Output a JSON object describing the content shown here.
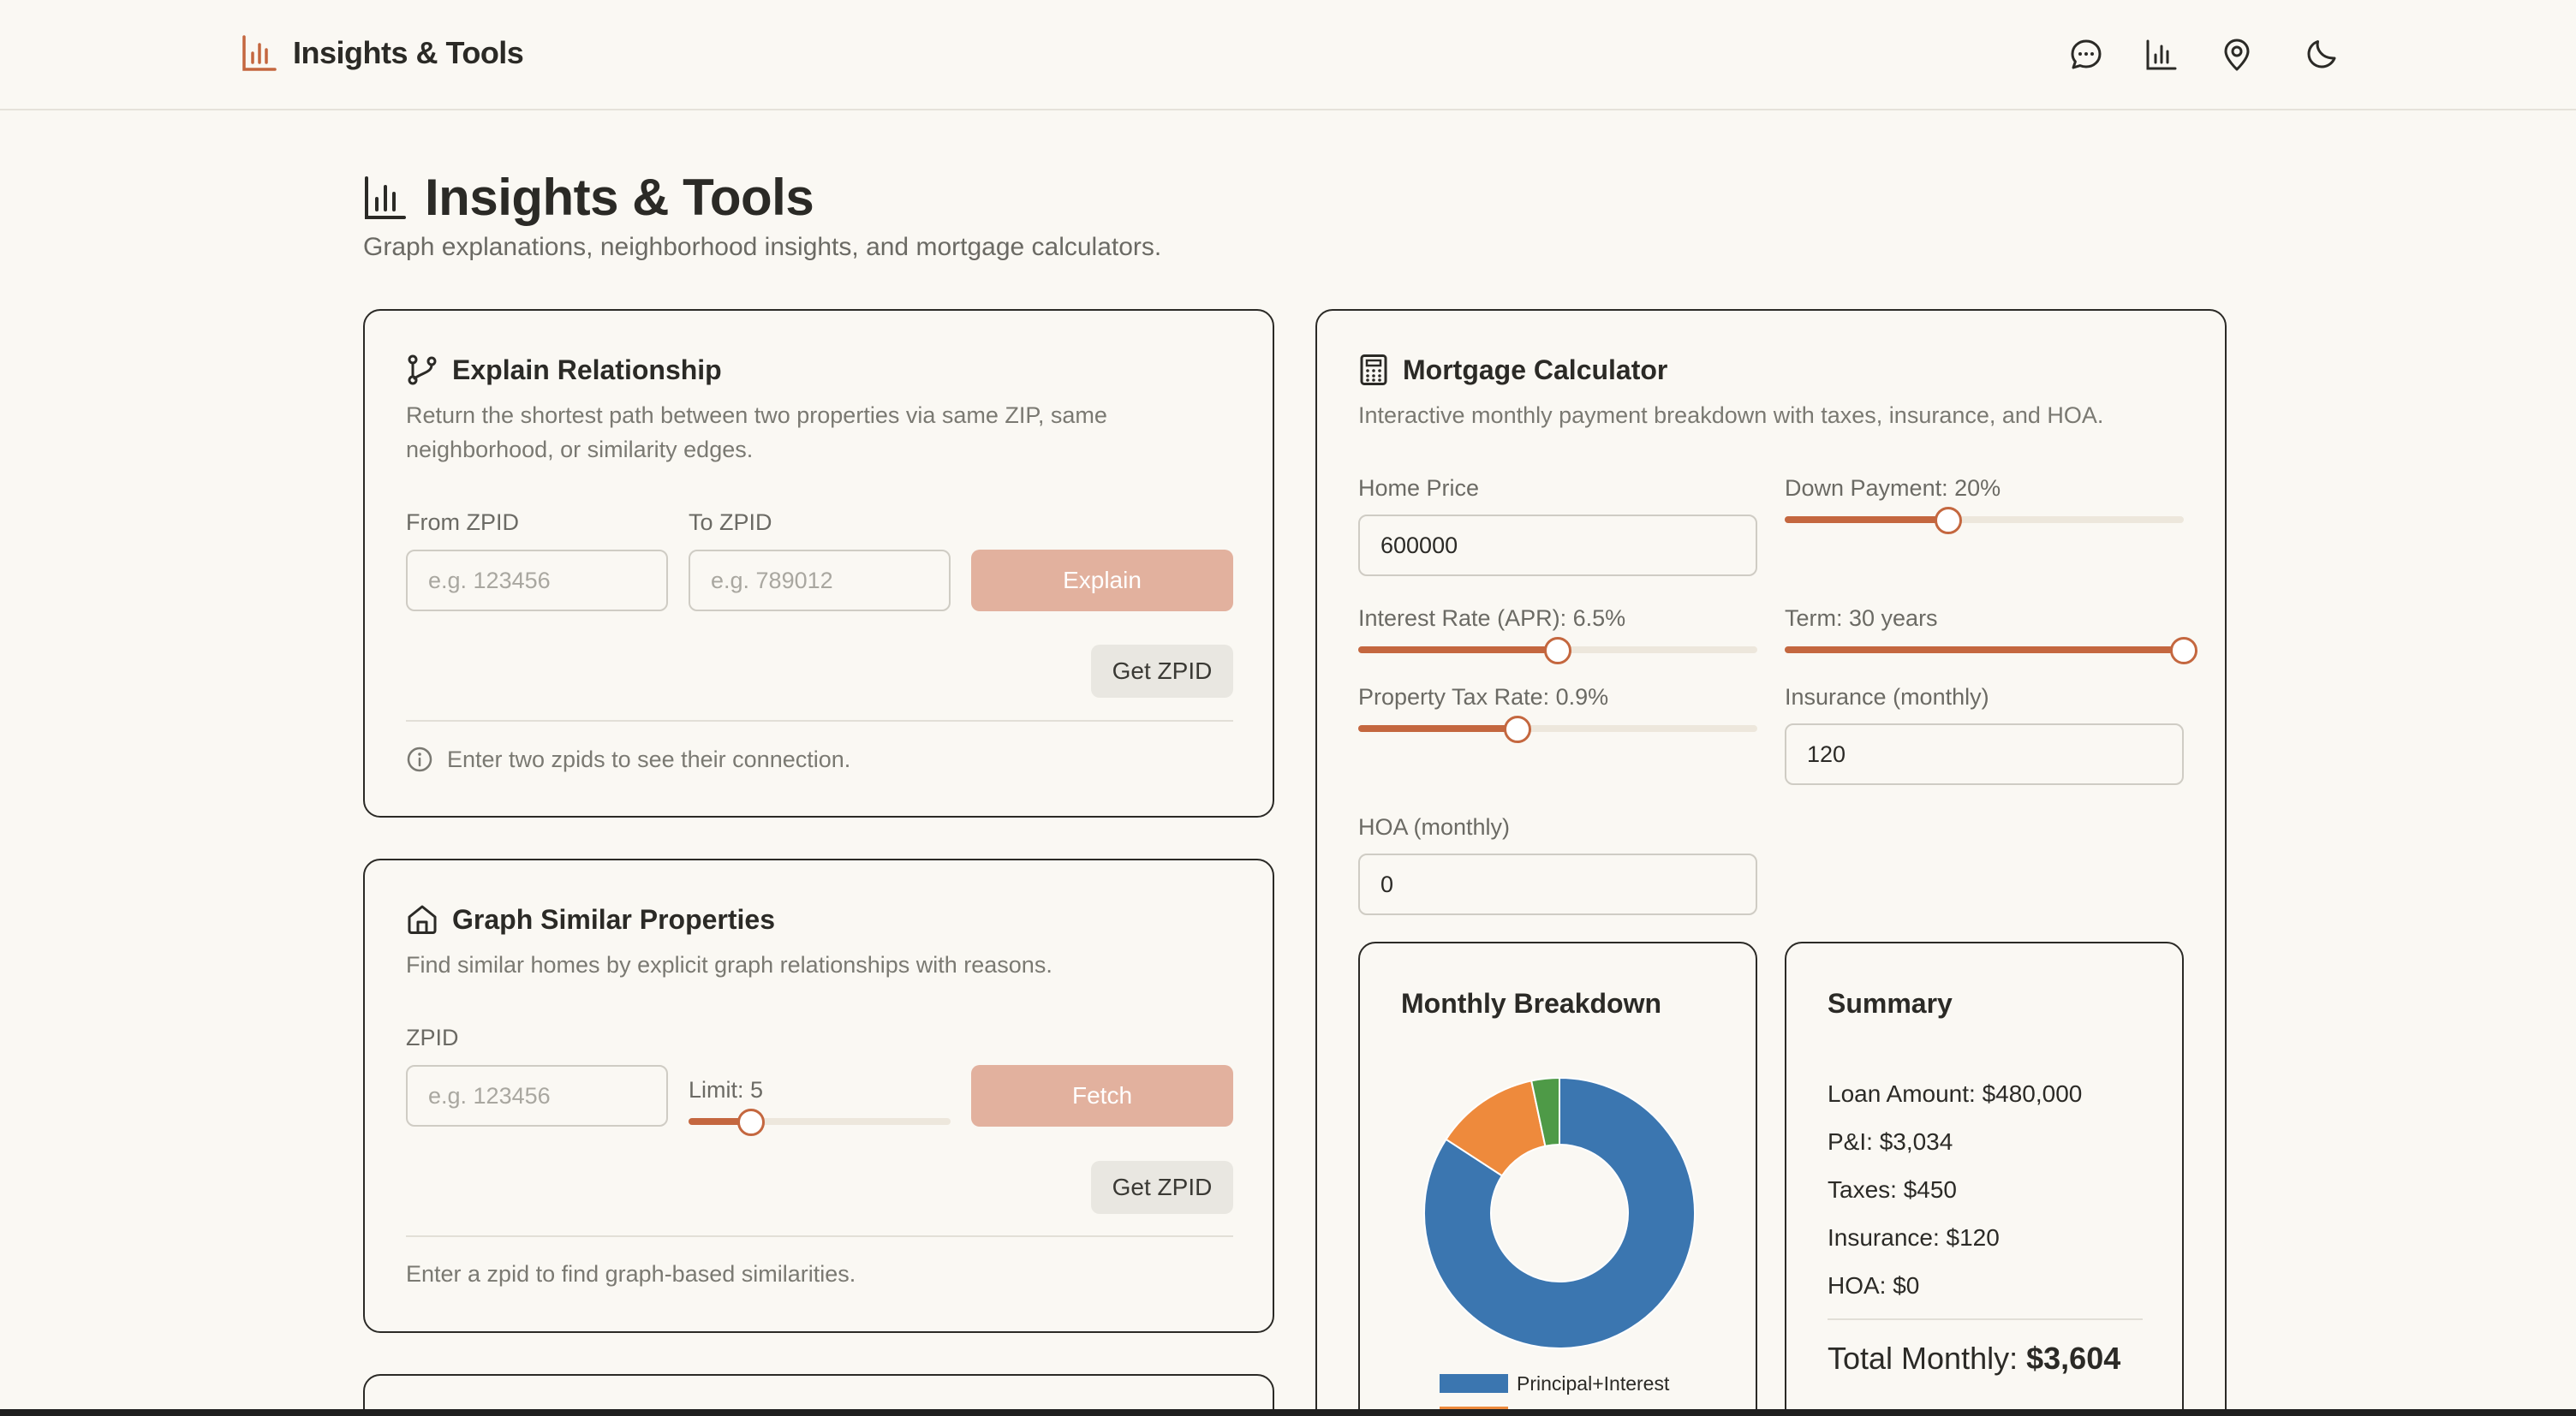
{
  "nav": {
    "brand": "Insights & Tools",
    "icons": [
      "chat-icon",
      "bar-chart-icon",
      "map-pin-icon",
      "moon-icon"
    ]
  },
  "page": {
    "title": "Insights & Tools",
    "subtitle": "Graph explanations, neighborhood insights, and mortgage calculators."
  },
  "explain": {
    "title": "Explain Relationship",
    "desc_line1": "Return the shortest path between two properties via same ZIP, same",
    "desc_line2": "neighborhood, or similarity edges.",
    "from_label": "From ZPID",
    "from_placeholder": "e.g. 123456",
    "to_label": "To ZPID",
    "to_placeholder": "e.g. 789012",
    "explain_button": "Explain",
    "get_zpid_button": "Get ZPID",
    "hint": "Enter two zpids to see their connection."
  },
  "similar": {
    "title": "Graph Similar Properties",
    "desc": "Find similar homes by explicit graph relationships with reasons.",
    "zpid_label": "ZPID",
    "zpid_placeholder": "e.g. 123456",
    "limit_label": "Limit: 5",
    "limit_value": 5,
    "limit_fraction": 0.24,
    "fetch_button": "Fetch",
    "get_zpid_button": "Get ZPID",
    "hint": "Enter a zpid to find graph-based similarities."
  },
  "mortgage": {
    "title": "Mortgage Calculator",
    "desc": "Interactive monthly payment breakdown with taxes, insurance, and HOA.",
    "home_price_label": "Home Price",
    "home_price_value": "600000",
    "down_payment_label": "Down Payment: 20%",
    "down_payment_fraction": 0.41,
    "interest_label": "Interest Rate (APR): 6.5%",
    "interest_fraction": 0.5,
    "term_label": "Term: 30 years",
    "term_fraction": 1.0,
    "tax_label": "Property Tax Rate: 0.9%",
    "tax_fraction": 0.4,
    "insurance_label": "Insurance (monthly)",
    "insurance_value": "120",
    "hoa_label": "HOA (monthly)",
    "hoa_value": "0",
    "breakdown_title": "Monthly Breakdown",
    "summary": {
      "title": "Summary",
      "loan_amount": "Loan Amount: $480,000",
      "pi": "P&I: $3,034",
      "taxes": "Taxes: $450",
      "insurance": "Insurance: $120",
      "hoa": "HOA: $0",
      "total_prefix": "Total Monthly:",
      "total_value": "$3,604"
    }
  },
  "chart_data": {
    "type": "pie",
    "categories": [
      "Principal+Interest",
      "Taxes",
      "Insurance",
      "HOA"
    ],
    "values": [
      3034,
      450,
      120,
      0
    ],
    "colors": [
      "#3b76b0",
      "#ee8a3c",
      "#4e9a47",
      "#c94a48"
    ],
    "legend_visible": [
      "Principal+Interest",
      "Taxes"
    ],
    "legend_placement": "bottom"
  },
  "colors": {
    "accent": "#c4673f",
    "button_primary": "#e2b19e",
    "background": "#faf8f3"
  }
}
